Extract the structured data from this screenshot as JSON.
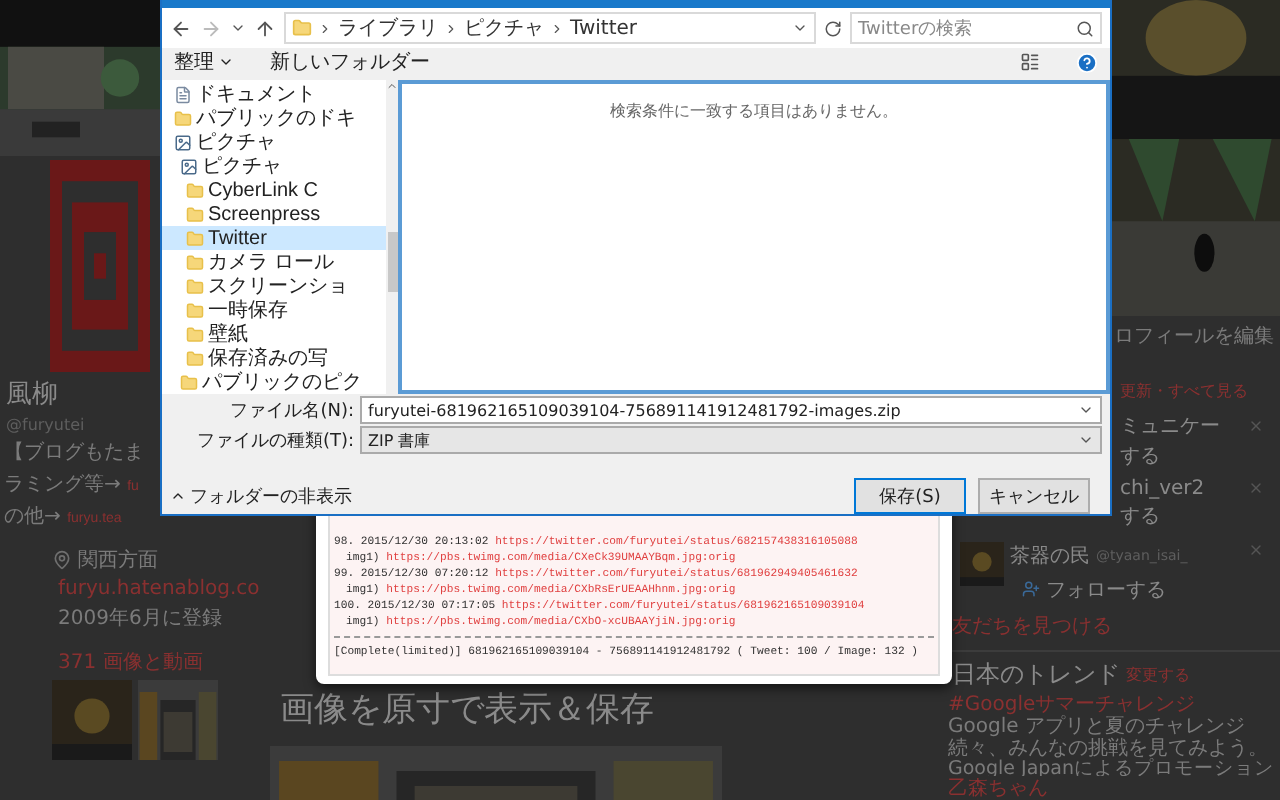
{
  "profile": {
    "name": "風柳",
    "handle": "@furyutei",
    "bio": [
      {
        "text": "【ブログもたま"
      },
      {
        "text": "ラミング等→ ",
        "link": "fu"
      },
      {
        "text": "の他→ ",
        "link": "furyu.tea"
      }
    ],
    "location": "関西方面",
    "website": "furyu.hatenablog.co",
    "joined": "2009年6月に登録",
    "media": "371 画像と動画"
  },
  "feature_heading": "画像を原寸で表示＆保存",
  "sidebar": {
    "edit_profile": "ロフィールを編集",
    "refresh": "更新・すべて見る",
    "users": [
      {
        "name": "ミュニケー",
        "action": "する"
      },
      {
        "name": "chi_ver2",
        "action": "する"
      },
      {
        "name": "茶器の民",
        "handle": "@tyaan_isai_",
        "action": "フォローする"
      }
    ],
    "find_friends": "友だちを見つける",
    "trends_title": "日本のトレンド",
    "trends_change": "変更する",
    "trends": [
      {
        "name": "#Googleサマーチャレンジ",
        "description": "Google アプリと夏のチャレンジ続々、みんなの挑戦を見てみよう。",
        "promoted": "Google Japanによるプロモーション"
      },
      {
        "name": "乙森ちゃん"
      }
    ]
  },
  "log": {
    "lines": [
      {
        "kind": "tweet",
        "text": "98. 2015/12/30 20:13:02 ",
        "url": "https://twitter.com/furyutei/status/682157438316105088"
      },
      {
        "text": "img1) ",
        "url": "https://pbs.twimg.com/media/CXeCk39UMAAYBqm.jpg:orig"
      },
      {
        "kind": "tweet",
        "text": "99. 2015/12/30 07:20:12 ",
        "url": "https://twitter.com/furyutei/status/681962949405461632"
      },
      {
        "text": "img1) ",
        "url": "https://pbs.twimg.com/media/CXbRsErUEAAHhnm.jpg:orig"
      },
      {
        "kind": "tweet",
        "text": "100. 2015/12/30 07:17:05 ",
        "url": "https://twitter.com/furyutei/status/681962165109039104"
      },
      {
        "text": "img1) ",
        "url": "https://pbs.twimg.com/media/CXbO-xcUBAAYjiN.jpg:orig"
      }
    ],
    "summary": "[Complete(limited)] 681962165109039104 - 756891141912481792 ( Tweet: 100 / Image: 132 )"
  },
  "dialog": {
    "breadcrumb": [
      "ライブラリ",
      "ピクチャ",
      "Twitter"
    ],
    "search": {
      "placeholder": "Twitterの検索"
    },
    "toolbar": [
      "整理",
      "新しいフォルダー"
    ],
    "tree": [
      {
        "label": "ドキュメント",
        "kind": "document",
        "selected": false
      },
      {
        "label": "パブリックのドキ",
        "kind": "folder",
        "selected": false
      },
      {
        "label": "ピクチャ",
        "kind": "library",
        "selected": false,
        "children": [
          {
            "label": "ピクチャ",
            "kind": "library",
            "selected": false,
            "children": [
              {
                "label": "CyberLink C",
                "kind": "folder",
                "selected": false
              },
              {
                "label": "Screenpress",
                "kind": "folder",
                "selected": false
              },
              {
                "label": "Twitter",
                "kind": "folder",
                "selected": true
              },
              {
                "label": "カメラ ロール",
                "kind": "folder",
                "selected": false
              },
              {
                "label": "スクリーンショ",
                "kind": "folder",
                "selected": false
              },
              {
                "label": "一時保存",
                "kind": "folder",
                "selected": false
              },
              {
                "label": "壁紙",
                "kind": "folder",
                "selected": false
              },
              {
                "label": "保存済みの写",
                "kind": "folder",
                "selected": false
              }
            ]
          },
          {
            "label": "パブリックのピク",
            "kind": "folder",
            "selected": false
          }
        ]
      }
    ],
    "empty_message": "検索条件に一致する項目はありません。",
    "fields": [
      {
        "kind": "input",
        "label": "ファイル名(N):",
        "value": "furyutei-681962165109039104-756891141912481792-images.zip"
      },
      {
        "kind": "select",
        "label": "ファイルの種類(T):",
        "value": "ZIP 書庫"
      }
    ],
    "hide_folders": "フォルダーの非表示",
    "buttons": [
      {
        "label": "保存(S)",
        "default": true
      },
      {
        "label": "キャンセル",
        "default": false
      }
    ]
  }
}
